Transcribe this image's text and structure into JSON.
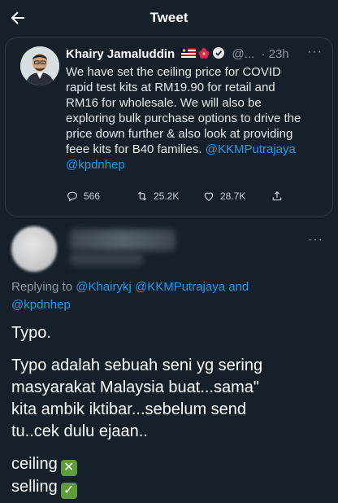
{
  "header": {
    "title": "Tweet"
  },
  "quoted_tweet": {
    "author_name": "Khairy Jamaluddin",
    "handle": "@...",
    "time": "· 23h",
    "more": "···",
    "text_lines": [
      "We have set the ceiling price for COVID",
      "rapid test kits at RM19.90 for retail and",
      "RM16 for wholesale. We will also be",
      "exploring bulk purchase options to drive the",
      "price down further & also look at providing"
    ],
    "text_last_line": "feee kits for B40 families.",
    "mention_1": "@KKMPutrajaya",
    "mention_2": "@kpdnhep",
    "actions": {
      "replies": "566",
      "retweets": "25.2K",
      "likes": "28.7K"
    },
    "colors": {
      "mention": "#1d9bf0",
      "background": "#15202b"
    }
  },
  "reply": {
    "more": "···",
    "replying_to_prefix": "Replying to",
    "replying_to_mentions": "@Khairykj @KKMPutrajaya and",
    "replying_to_last": "@kpdnhep",
    "body_lines": [
      "Typo.",
      "Typo adalah sebuah seni yg sering",
      "masyarakat Malaysia buat...sama\"",
      "kita ambik iktibar...sebelum send",
      "tu..cek dulu ejaan.."
    ],
    "wrong_word": "ceiling",
    "right_word": "selling",
    "wrong_icon": "cross-mark-icon",
    "right_icon": "check-mark-icon"
  }
}
